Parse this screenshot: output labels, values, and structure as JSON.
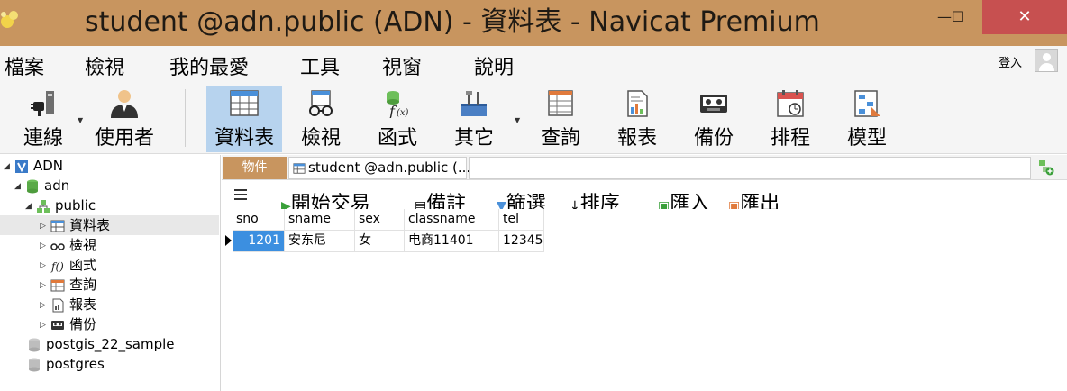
{
  "window": {
    "title": "student @adn.public (ADN) - 資料表 - Navicat Premium",
    "minimize": "—",
    "maximize": "☐",
    "close": "✕"
  },
  "menu": {
    "items": [
      "檔案",
      "檢視",
      "我的最愛",
      "工具",
      "視窗",
      "說明"
    ],
    "login": "登入"
  },
  "toolbar": {
    "items": [
      {
        "label": "連線",
        "icon": "plug-icon"
      },
      {
        "label": "使用者",
        "icon": "user-icon"
      },
      {
        "label": "資料表",
        "icon": "table-icon"
      },
      {
        "label": "檢視",
        "icon": "view-glasses-icon"
      },
      {
        "label": "函式",
        "icon": "function-icon"
      },
      {
        "label": "其它",
        "icon": "tools-icon"
      },
      {
        "label": "查詢",
        "icon": "query-icon"
      },
      {
        "label": "報表",
        "icon": "report-icon"
      },
      {
        "label": "備份",
        "icon": "backup-icon"
      },
      {
        "label": "排程",
        "icon": "calendar-icon"
      },
      {
        "label": "模型",
        "icon": "model-icon"
      }
    ],
    "active": "資料表"
  },
  "tree": {
    "connection": "ADN",
    "database": "adn",
    "schema": "public",
    "children": [
      "資料表",
      "檢視",
      "函式",
      "查詢",
      "報表",
      "備份"
    ],
    "other_databases": [
      "postgis_22_sample",
      "postgres"
    ]
  },
  "tabs": {
    "objects": "物件",
    "document": "student @adn.public (..."
  },
  "gridbar": {
    "items": [
      "開始交易",
      "備註",
      "篩選",
      "排序",
      "匯入",
      "匯出"
    ]
  },
  "table": {
    "columns": [
      "sno",
      "sname",
      "sex",
      "classname",
      "tel"
    ],
    "rows": [
      [
        "1201",
        "安东尼",
        "女",
        "电商11401",
        "12345"
      ]
    ]
  },
  "colors": {
    "titlebar": "#c8955f",
    "close": "#c75050",
    "active_tool": "#b7d3ee",
    "selected_cell": "#3c8fe0"
  }
}
